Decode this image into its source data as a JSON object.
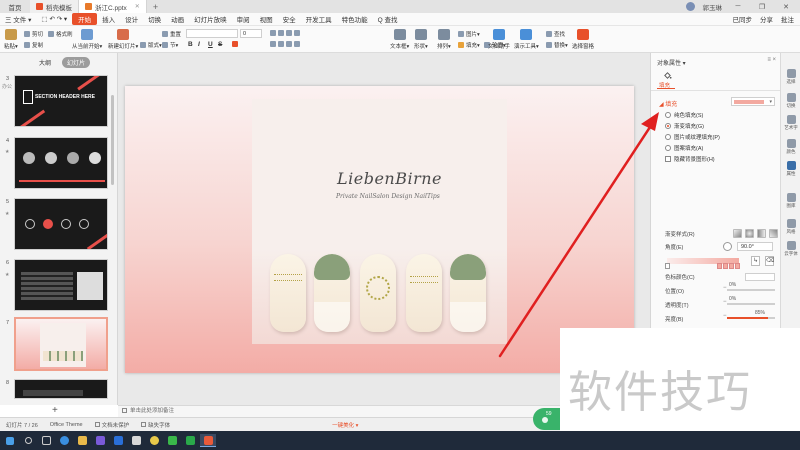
{
  "titlebar": {
    "tabs": [
      {
        "label": "首页"
      },
      {
        "label": "稻壳模板"
      },
      {
        "label": "浙江C.pptx"
      }
    ],
    "user": "郭玉琳",
    "window_controls": [
      "─",
      "❐",
      "✕"
    ]
  },
  "menu": {
    "file": "三 文件 ▾",
    "items": [
      "开始",
      "插入",
      "设计",
      "切换",
      "动画",
      "幻灯片放映",
      "审阅",
      "视图",
      "安全",
      "开发工具",
      "特色功能"
    ],
    "search": "Q 查找",
    "right": [
      "已同步",
      "分享",
      "批注"
    ]
  },
  "ribbon": {
    "paste": "粘贴▾",
    "cut": "剪切",
    "copy": "复制",
    "format_painter": "格式刷",
    "from_current": "从当前开始▾",
    "new_slide": "新建幻灯片▾",
    "layout": "版式▾",
    "section": "节▾",
    "reset": "重置",
    "font_size_value": "0",
    "format_buttons": [
      "B",
      "I",
      "U",
      "S"
    ],
    "textbox": "文本框▾",
    "shape": "形状▾",
    "arrange": "排列▾",
    "image": "图片▾",
    "fill": "填充▾",
    "outline": "轮廓▾",
    "doc_helper": "文档助手",
    "presentation_tools": "演示工具▾",
    "find": "查找",
    "replace": "替换▾",
    "select_pane": "选择窗格"
  },
  "left_panel": {
    "tabs": [
      "大纲",
      "幻灯片"
    ],
    "tag": "办公",
    "thumbnails": [
      {
        "num": "3",
        "title": "SECTION HEADER HERE"
      },
      {
        "num": "4"
      },
      {
        "num": "5"
      },
      {
        "num": "6"
      },
      {
        "num": "7"
      },
      {
        "num": "8"
      }
    ],
    "add": "+"
  },
  "slide": {
    "logo": "LiebenBirne",
    "tagline": "Private NailSalon Design NailTips"
  },
  "notes": "单击此处添加备注",
  "pane": {
    "title": "对象属性 ▾",
    "controls": "≡ ×",
    "tab": "填充",
    "fill_header": "◢ 填充",
    "options": [
      {
        "label": "纯色填充(S)",
        "checked": false
      },
      {
        "label": "渐变填充(G)",
        "checked": true
      },
      {
        "label": "图片或纹理填充(P)",
        "checked": false
      },
      {
        "label": "图案填充(A)",
        "checked": false
      }
    ],
    "hide_bg": "隐藏背景图形(H)",
    "gradient_style": "渐变样式(R)",
    "angle_label": "角度(E)",
    "angle_value": "90.0°",
    "color_label": "色标颜色(C)",
    "position_label": "位置(O)",
    "position_value": "0%",
    "transparency_label": "透明度(T)",
    "transparency_value": "0%",
    "brightness_label": "亮度(B)",
    "brightness_value": "85%",
    "brightness_fraction": 0.85,
    "rotate_with_shape": "与形状一起旋转(W)",
    "accent_color": "#e8502a"
  },
  "strip": [
    "选择",
    "切换",
    "艺术字",
    "颜色",
    "属性",
    "图库",
    "风格",
    "云字体"
  ],
  "statusbar": {
    "slide_count": "幻灯片 7 / 26",
    "theme": "Office Theme",
    "doc_protect": "文档未保护",
    "missing_font": "缺失字体",
    "beautify": "一键美化 ▾"
  },
  "watermark": "软件技巧",
  "widget": "59"
}
